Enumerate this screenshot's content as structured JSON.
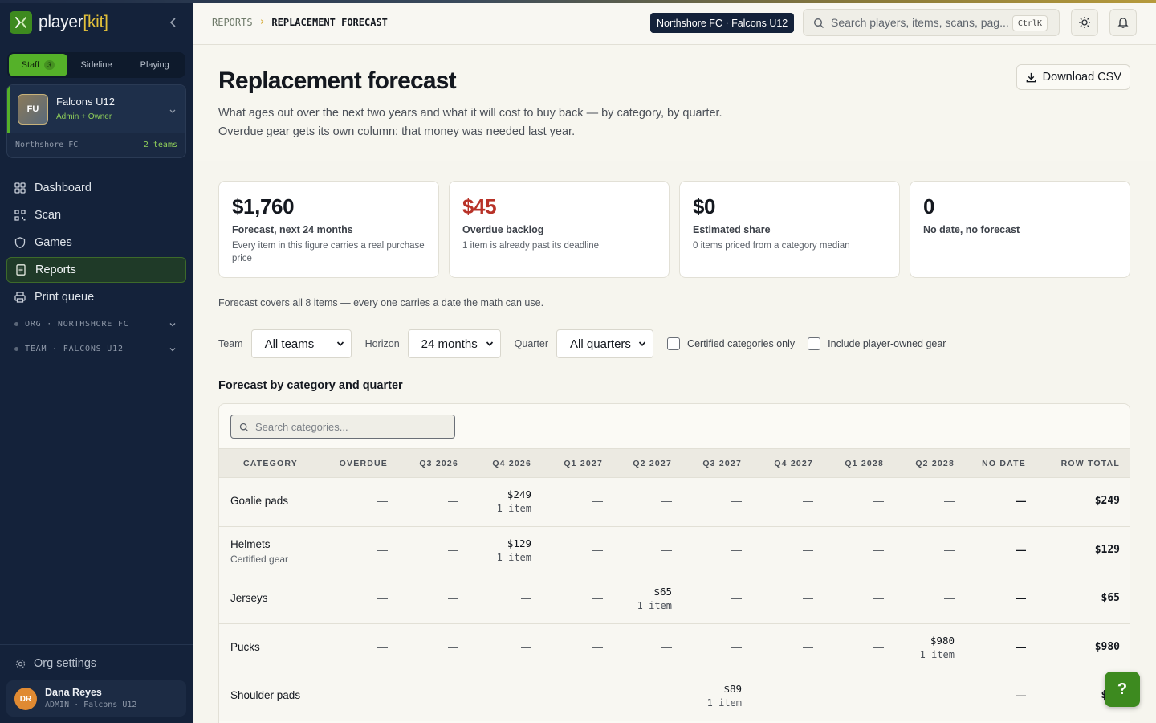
{
  "app": {
    "brand_prefix": "player",
    "brand_open": "[",
    "brand_accent": "kit",
    "brand_close": "]"
  },
  "modes": [
    {
      "label": "Staff",
      "count": "3",
      "active": true
    },
    {
      "label": "Sideline",
      "count": "",
      "active": false
    },
    {
      "label": "Playing",
      "count": "",
      "active": false
    }
  ],
  "team_switcher": {
    "initials": "FU",
    "name": "Falcons U12",
    "role": "Admin + Owner",
    "org": "Northshore FC",
    "team_count": "2 teams"
  },
  "nav": {
    "items": [
      {
        "label": "Dashboard",
        "icon": "grid-icon",
        "active": false
      },
      {
        "label": "Scan",
        "icon": "qr-icon",
        "active": false
      },
      {
        "label": "Games",
        "icon": "shield-icon",
        "active": false
      },
      {
        "label": "Reports",
        "icon": "report-icon",
        "active": true
      },
      {
        "label": "Print queue",
        "icon": "printer-icon",
        "active": false
      }
    ],
    "groups": [
      "ORG · NORTHSHORE FC",
      "TEAM · FALCONS U12"
    ],
    "settings": "Org settings"
  },
  "user": {
    "initials": "DR",
    "name": "Dana Reyes",
    "role": "ADMIN · Falcons U12"
  },
  "topbar": {
    "breadcrumb": [
      "REPORTS",
      "REPLACEMENT FORECAST"
    ],
    "context": "Northshore FC · Falcons U12",
    "search_placeholder": "Search players, items, scans, pag...",
    "shortcut": "CtrlK"
  },
  "header": {
    "title": "Replacement forecast",
    "description": "What ages out over the next two years and what it will cost to buy back — by category, by quarter. Overdue gear gets its own column: that money was needed last year.",
    "download": "Download CSV"
  },
  "kpis": [
    {
      "value": "$1,760",
      "label": "Forecast, next 24 months",
      "desc": "Every item in this figure carries a real purchase price",
      "tone": "normal"
    },
    {
      "value": "$45",
      "label": "Overdue backlog",
      "desc": "1 item is already past its deadline",
      "tone": "red"
    },
    {
      "value": "$0",
      "label": "Estimated share",
      "desc": "0 items priced from a category median",
      "tone": "normal"
    },
    {
      "value": "0",
      "label": "No date, no forecast",
      "desc": "",
      "tone": "normal"
    }
  ],
  "coverage": "Forecast covers all 8 items — every one carries a date the math can use.",
  "filters": {
    "team_label": "Team",
    "team_value": "All teams",
    "horizon_label": "Horizon",
    "horizon_value": "24 months",
    "quarter_label": "Quarter",
    "quarter_value": "All quarters",
    "certified": "Certified categories only",
    "player_owned": "Include player-owned gear"
  },
  "table": {
    "title": "Forecast by category and quarter",
    "search_placeholder": "Search categories...",
    "columns": [
      "CATEGORY",
      "OVERDUE",
      "Q3 2026",
      "Q4 2026",
      "Q1 2027",
      "Q2 2027",
      "Q3 2027",
      "Q4 2027",
      "Q1 2028",
      "Q2 2028",
      "NO DATE",
      "ROW TOTAL"
    ],
    "rows": [
      {
        "category": "Goalie pads",
        "sub": "",
        "cells": [
          "—",
          "—",
          "$249|1 item",
          "—",
          "—",
          "—",
          "—",
          "—",
          "—"
        ],
        "no_date": "—",
        "total": "$249"
      },
      {
        "category": "Helmets",
        "sub": "Certified gear",
        "cells": [
          "—",
          "—",
          "$129|1 item",
          "—",
          "—",
          "—",
          "—",
          "—",
          "—"
        ],
        "no_date": "—",
        "total": "$129"
      },
      {
        "category": "Jerseys",
        "sub": "",
        "cells": [
          "—",
          "—",
          "—",
          "—",
          "$65|1 item",
          "—",
          "—",
          "—",
          "—"
        ],
        "no_date": "—",
        "total": "$65"
      },
      {
        "category": "Pucks",
        "sub": "",
        "cells": [
          "—",
          "—",
          "—",
          "—",
          "—",
          "—",
          "—",
          "—",
          "$980|1 item"
        ],
        "no_date": "—",
        "total": "$980"
      },
      {
        "category": "Shoulder pads",
        "sub": "",
        "cells": [
          "—",
          "—",
          "—",
          "—",
          "—",
          "$89|1 item",
          "—",
          "—",
          "—"
        ],
        "no_date": "—",
        "total": "$89"
      }
    ]
  },
  "help": "?"
}
